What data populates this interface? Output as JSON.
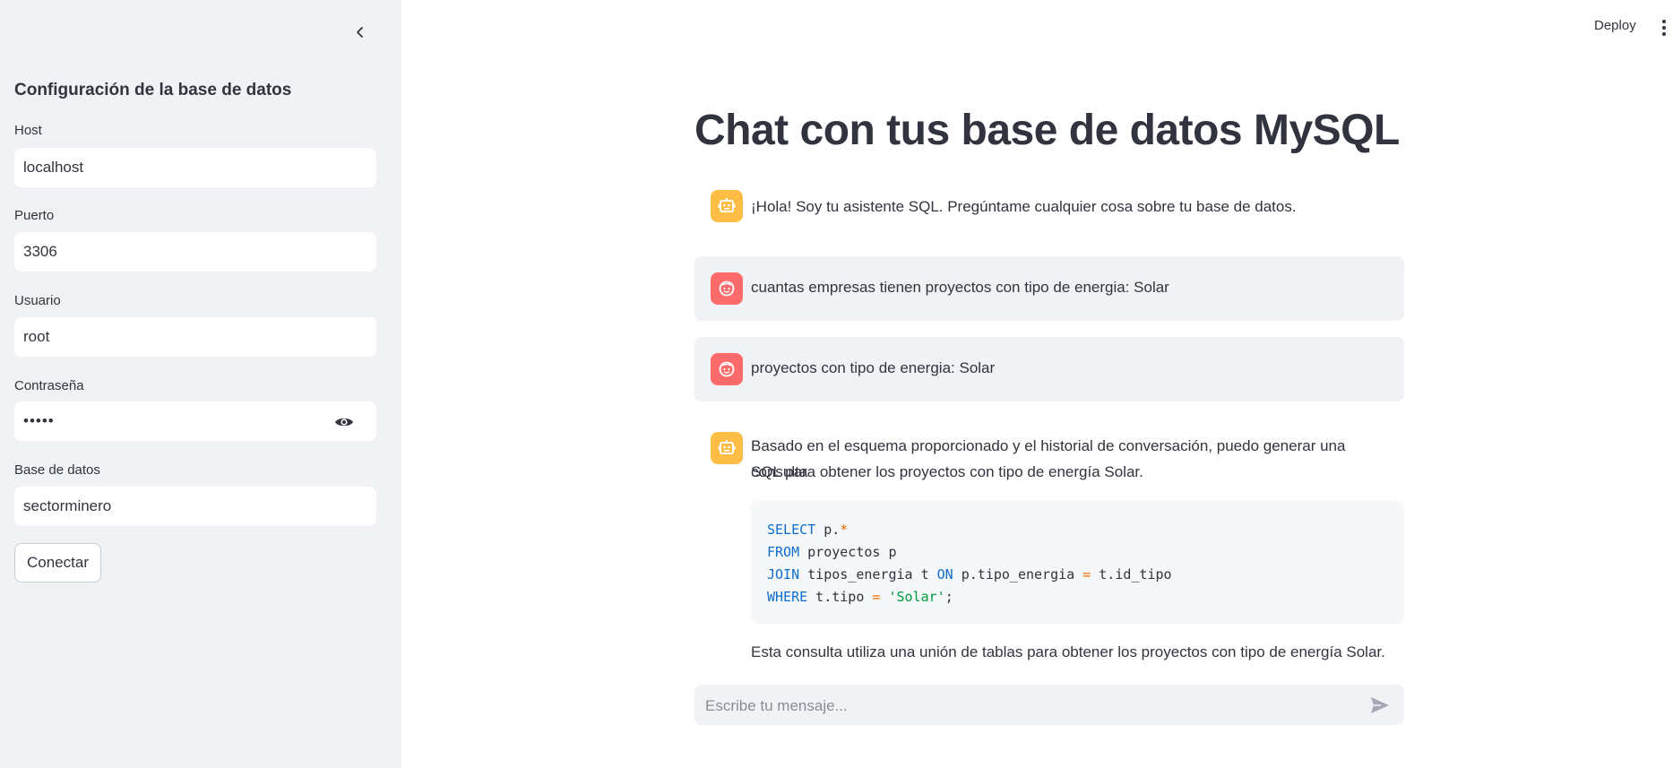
{
  "sidebar": {
    "title": "Configuración de la base de datos",
    "fields": [
      {
        "label": "Host",
        "value": "localhost"
      },
      {
        "label": "Puerto",
        "value": "3306"
      },
      {
        "label": "Usuario",
        "value": "root"
      },
      {
        "label": "Contraseña",
        "value": "•••••"
      },
      {
        "label": "Base de datos",
        "value": "sectorminero"
      }
    ],
    "connect_label": "Conectar"
  },
  "header": {
    "deploy_label": "Deploy"
  },
  "main": {
    "title": "Chat con tus base de datos MySQL",
    "messages": [
      {
        "role": "assistant",
        "text": "¡Hola! Soy tu asistente SQL. Pregúntame cualquier cosa sobre tu base de datos."
      },
      {
        "role": "user",
        "text": "cuantas empresas tienen proyectos con tipo de energia: Solar"
      },
      {
        "role": "user",
        "text": "proyectos con tipo de energia: Solar"
      },
      {
        "role": "assistant",
        "text_line1": "Basado en el esquema proporcionado y el historial de conversación, puedo generar una consulta",
        "text_line2": "SQL para obtener los proyectos con tipo de energía Solar.",
        "code": {
          "l1_kw": "SELECT",
          "l1_rest": " p.",
          "l1_op": "*",
          "l2_kw": "FROM",
          "l2_rest": " proyectos p",
          "l3_kw1": "JOIN",
          "l3_mid": " tipos_energia t ",
          "l3_kw2": "ON",
          "l3_rest1": " p.tipo_energia ",
          "l3_op": "=",
          "l3_rest2": " t.id_tipo",
          "l4_kw": "WHERE",
          "l4_rest1": " t.tipo ",
          "l4_op": "=",
          "l4_sp": " ",
          "l4_str": "'Solar'",
          "l4_end": ";"
        },
        "footer": "Esta consulta utiliza una unión de tablas para obtener los proyectos con tipo de energía Solar."
      }
    ],
    "chat_placeholder": "Escribe tu mensaje..."
  },
  "colors": {
    "sidebar_bg": "#f0f2f6",
    "bot_avatar": "#ffbd45",
    "user_avatar": "#ff6b6b",
    "keyword": "#0d6ecf",
    "operator": "#f26d00",
    "string": "#009a3c"
  },
  "icons": {
    "collapse": "chevron-left-icon",
    "eye": "eye-icon",
    "menu": "vertical-dots-icon",
    "bot": "robot-icon",
    "user": "face-icon",
    "send": "send-icon"
  }
}
